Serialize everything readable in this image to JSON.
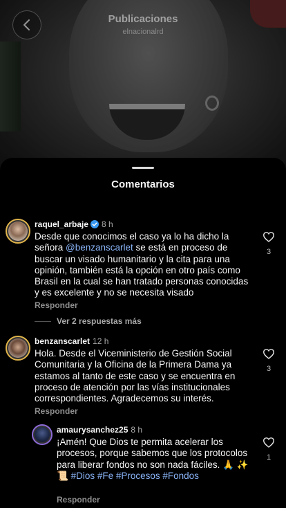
{
  "header": {
    "title": "Publicaciones",
    "account": "elnacionalrd"
  },
  "sheet": {
    "title": "Comentarios"
  },
  "comments": [
    {
      "username": "raquel_arbaje",
      "verified": true,
      "time": "8 h",
      "text_before": "Desde que conocimos el caso ya lo ha dicho la señora ",
      "mention": "@benzanscarlet",
      "text_after": " se está en proceso de buscar un visado humanitario y la cita para una opinión, también está la opción en otro país como Brasil en la cual se han tratado personas conocidas y es excelente y no se necesita visado",
      "reply_label": "Responder",
      "likes": "3",
      "view_replies": "Ver 2 respuestas más"
    },
    {
      "username": "benzanscarlet",
      "time": "12 h",
      "text": "Hola. Desde el Viceministerio de Gestión Social Comunitaria y la Oficina de la Primera Dama ya estamos al tanto de este caso y se encuentra en proceso de atención por las vías institucionales correspondientes. Agradecemos su interés.",
      "reply_label": "Responder",
      "likes": "3"
    },
    {
      "username": "amaurysanchez25",
      "time": "8 h",
      "text": "¡Amén! Que Dios te permita acelerar los procesos, porque sabemos que los protocolos para liberar fondos no son nada fáciles. 🙏 ✨ 📜 ",
      "hashtags": "#Dios #Fe #Procesos #Fondos",
      "reply_label": "Responder",
      "likes": "1"
    }
  ],
  "colors": {
    "background": "#000000",
    "link": "#8ab4f8",
    "muted": "#8e8e8e",
    "verified": "#3897f0",
    "story_ring": "#e0b44a"
  },
  "icons": [
    "back-chevron-icon",
    "verified-badge-icon",
    "heart-icon"
  ]
}
